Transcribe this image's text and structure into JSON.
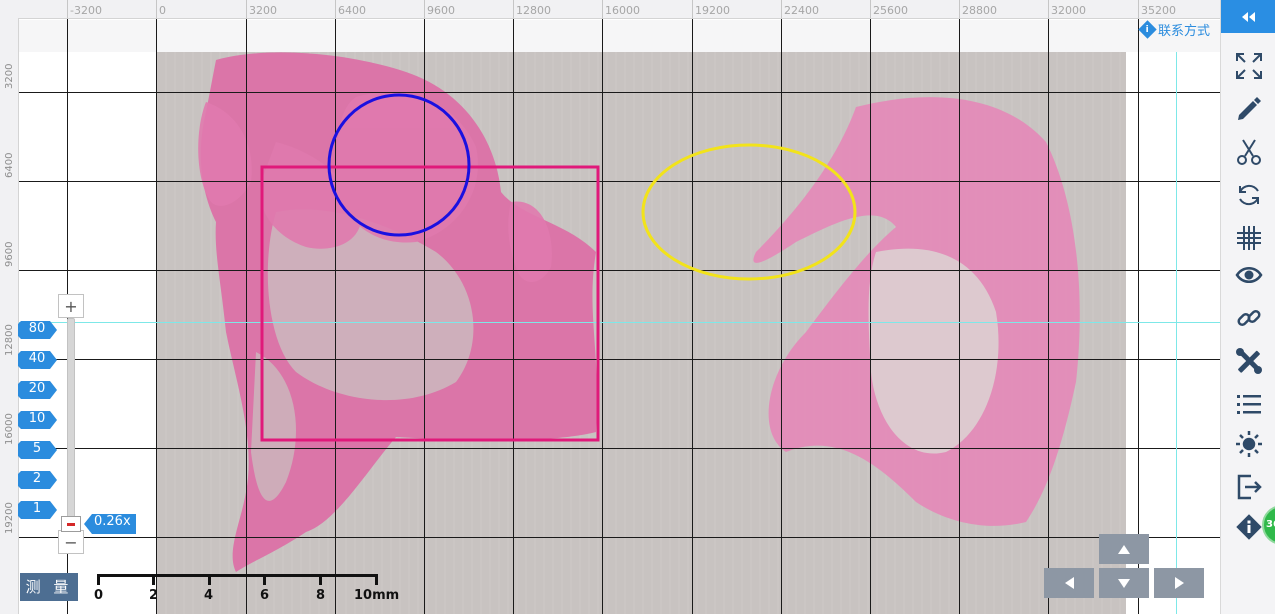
{
  "ruler": {
    "top_ticks": [
      "-3200",
      "0",
      "3200",
      "6400",
      "9600",
      "12800",
      "16000",
      "19200",
      "22400",
      "25600",
      "28800",
      "32000",
      "35200"
    ],
    "left_ticks": [
      "3200",
      "6400",
      "9600",
      "12800",
      "16000",
      "19200"
    ]
  },
  "header": {
    "contact_label": "联系方式"
  },
  "annotations": [
    {
      "shape": "rectangle",
      "color": "#e0197a"
    },
    {
      "shape": "circle",
      "color": "#1a10e0"
    },
    {
      "shape": "ellipse",
      "color": "#f2e31a"
    }
  ],
  "zoom": {
    "levels": [
      "80",
      "40",
      "20",
      "10",
      "5",
      "2",
      "1"
    ],
    "current": "0.26x",
    "plus_label": "+",
    "minus_label": "−"
  },
  "measure_label": "测 量",
  "scalebar": {
    "labels": [
      "0",
      "2",
      "4",
      "6",
      "8",
      "10mm"
    ]
  },
  "toolbar": {
    "tools": [
      "fullscreen-icon",
      "pencil-icon",
      "scissors-icon",
      "rotate-icon",
      "grid-icon",
      "eye-icon",
      "link-icon",
      "tools-icon",
      "list-icon",
      "brightness-icon",
      "export-icon",
      "info-icon"
    ],
    "badge_text": "36"
  },
  "colors": {
    "accent": "#2a8ee3",
    "zoom_badge": "#2b8cde",
    "grid": "#1a1a1a",
    "crosshair": "#7de8e8",
    "tissue": "#d9529a"
  }
}
